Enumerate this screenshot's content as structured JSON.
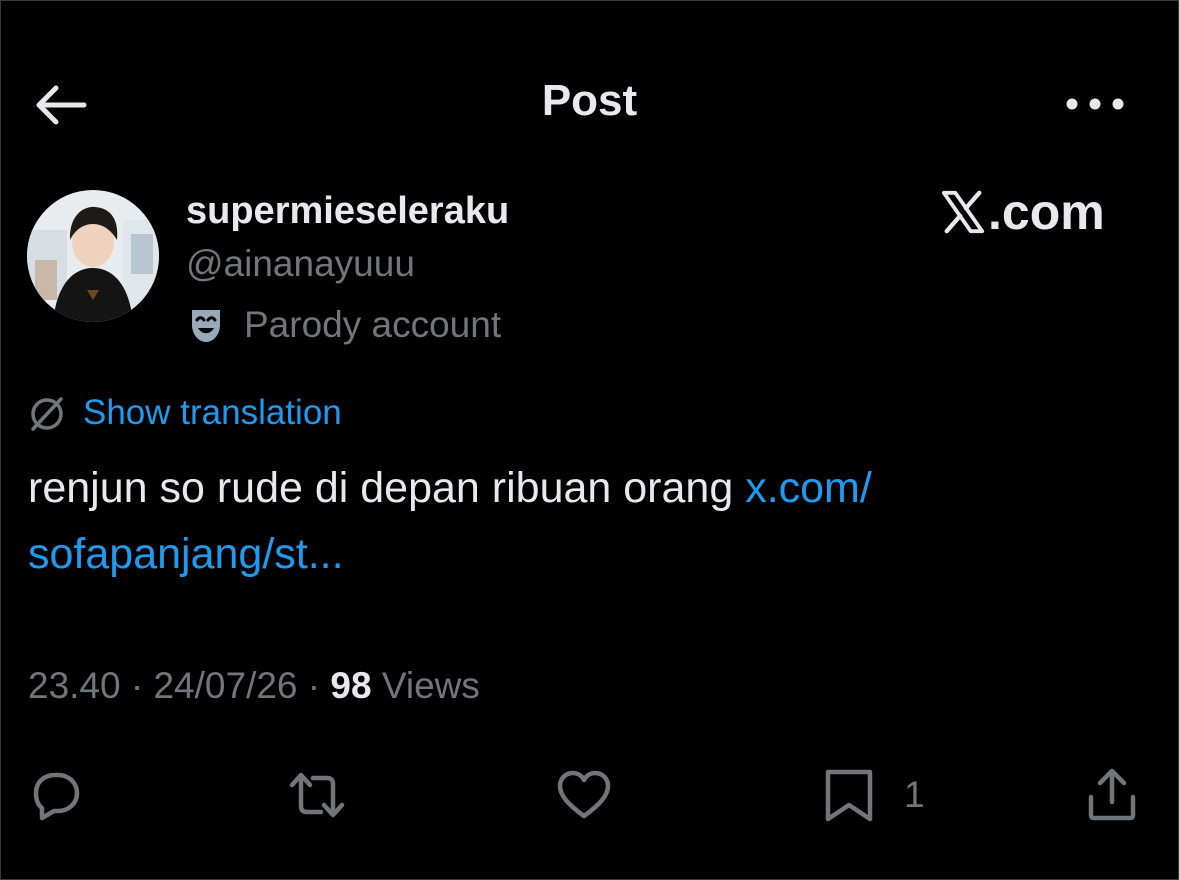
{
  "header": {
    "title": "Post"
  },
  "author": {
    "display_name": "supermieseleraku",
    "handle": "@ainanayuuu",
    "badge_label": "Parody account"
  },
  "branding": {
    "site_label": ".com"
  },
  "post": {
    "translate_label": "Show translation",
    "text": "renjun so rude di depan ribuan orang ",
    "link_part1": "x.com/",
    "link_part2": "sofapanjang/st..."
  },
  "meta": {
    "time": "23.40",
    "sep1": " · ",
    "date": "24/07/26",
    "sep2": " · ",
    "views_count": "98",
    "views_label": " Views"
  },
  "actions": {
    "bookmark_count": "1"
  },
  "colors": {
    "background": "#000000",
    "text_primary": "#e7e9ea",
    "text_secondary": "#71767b",
    "link": "#1d9bf0"
  },
  "icons": {
    "back": "arrow-left-icon",
    "more": "more-dots-icon",
    "parody": "theater-mask-icon",
    "translate": "translate-icon",
    "reply": "reply-icon",
    "repost": "repost-icon",
    "like": "heart-icon",
    "bookmark": "bookmark-icon",
    "share": "share-icon"
  }
}
